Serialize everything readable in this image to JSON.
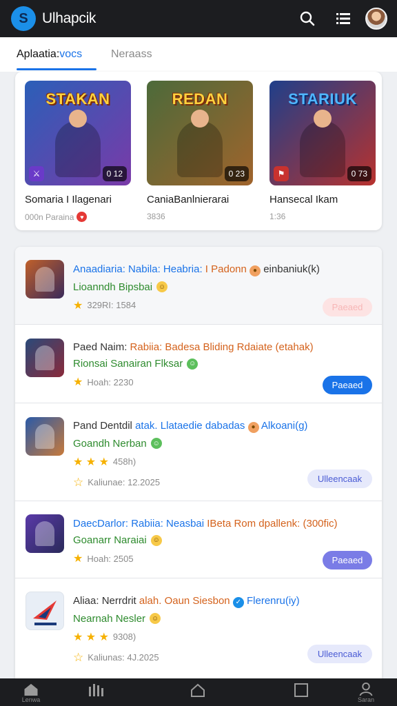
{
  "app": {
    "title": "Ulhapcik",
    "logo_letter": "S"
  },
  "topbar": {
    "icons": [
      "search-icon",
      "list-icon",
      "avatar"
    ]
  },
  "tabs": [
    {
      "label_main": "Aplaatia:",
      "label_accent": "vocs",
      "active": true
    },
    {
      "label": "Neraass",
      "active": false
    }
  ],
  "featured": [
    {
      "thumb_title": "STAKAN",
      "title": "Somaria I Ilagenari",
      "sub": "000n Paraina",
      "badge_count": "0 12",
      "colors": [
        "#2b5fb8",
        "#7a3aa8"
      ]
    },
    {
      "thumb_title": "REDAN",
      "title": "CaniaBanlnierarai",
      "sub": "3836",
      "badge_count": "0 23",
      "colors": [
        "#4c6a3a",
        "#a0642c"
      ]
    },
    {
      "thumb_title": "STARIUK",
      "title": "Hansecal Ikam",
      "sub": "1:36",
      "badge_count": "0 73",
      "colors": [
        "#1f3f8a",
        "#b8322e"
      ]
    }
  ],
  "list": [
    {
      "title_a": "Anaadiaria: Nabila: Heabria:",
      "title_b": "I Padonn",
      "title_c": "einbaniuk(k)",
      "sub": "Lioanndh Bipsbai",
      "meta": "329RI: 1584",
      "button": "Paeaed",
      "button_style": "faded",
      "icon_colors": [
        "#c0602a",
        "#3a2a5a"
      ]
    },
    {
      "title_a": "Paed Naim:",
      "title_b": "Rabiia: Badesa Bliding Rdaiate",
      "title_c": "(etahak)",
      "sub": "Rionsai Sanairan Flksar",
      "meta": "Hoah: 2230",
      "button": "Paeaed",
      "button_style": "blue",
      "icon_colors": [
        "#2a4a7a",
        "#8a2a3a"
      ]
    },
    {
      "title_a": "Pand Dentdil",
      "title_b": "atak. Llataedie dabadas",
      "title_c": "Alkoani(g)",
      "sub": "Goandh Nerban",
      "meta": "458h)",
      "meta2": "Kaliunae: 12.2025",
      "button": "Ulleencaak",
      "button_style": "light",
      "icon_colors": [
        "#2a5aa8",
        "#c87a3a"
      ]
    },
    {
      "title_a": "DaecDarlor: Rabiia: Neasbai",
      "title_b": "IBeta Rom dpallenk: (300fic)",
      "title_c": "",
      "sub": "Goanarr Naraiai",
      "meta": "Hoah: 2505",
      "button": "Paeaed",
      "button_style": "purple",
      "icon_colors": [
        "#5a3aa8",
        "#2a2a5a"
      ]
    },
    {
      "title_a": "Aliaa: Nerrdrit",
      "title_b": "alah. Oaun Siesbon",
      "title_c": "Flerenru(iy)",
      "sub": "Nearnah Nesler",
      "meta": "9308)",
      "meta2": "Kaliunas: 4J.2025",
      "button": "Ulleencaak",
      "button_style": "light",
      "icon_colors": [
        "#e8eef6",
        "#c8d8ea"
      ]
    }
  ],
  "bottomnav": [
    {
      "label": "Lenwa",
      "icon": "home-icon"
    },
    {
      "label": "",
      "icon": "chart-icon"
    },
    {
      "label": "",
      "icon": "house-outline-icon"
    },
    {
      "label": "",
      "icon": "square-icon"
    },
    {
      "label": "Saran",
      "icon": "profile-icon"
    }
  ]
}
